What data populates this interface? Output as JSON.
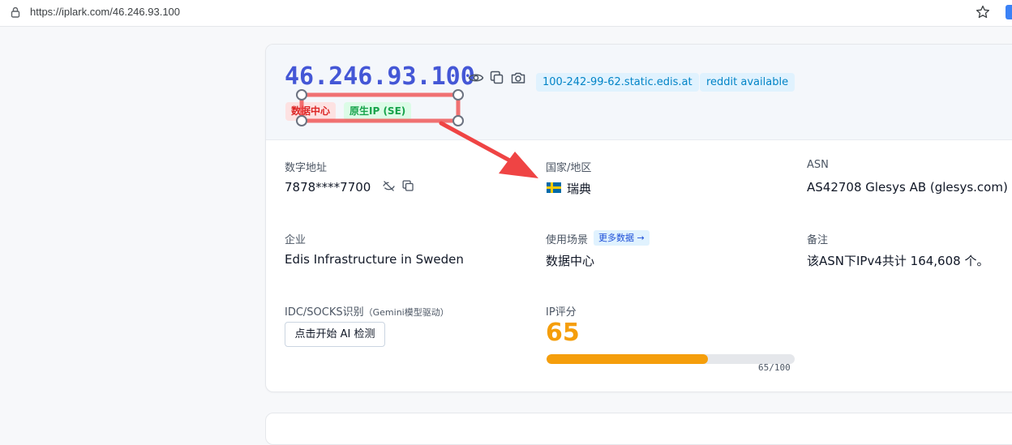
{
  "browser": {
    "url": "https://iplark.com/46.246.93.100"
  },
  "header": {
    "ip": "46.246.93.100",
    "hostname_chip": "100-242-99-62.static.edis.at",
    "reddit_chip": "reddit available",
    "tags": {
      "datacenter": "数据中心",
      "native": "原生IP (SE)"
    }
  },
  "fields": {
    "numeric": {
      "label": "数字地址",
      "value": "7878****7700"
    },
    "country": {
      "label": "国家/地区",
      "value": "瑞典"
    },
    "asn": {
      "label": "ASN",
      "value": "AS42708 Glesys AB (glesys.com)"
    },
    "company": {
      "label": "企业",
      "value": "Edis Infrastructure in Sweden"
    },
    "usage": {
      "label": "使用场景",
      "more": "更多数据 →",
      "value": "数据中心"
    },
    "note": {
      "label": "备注",
      "value": "该ASN下IPv4共计 164,608 个。"
    },
    "idc": {
      "label": "IDC/SOCKS识别",
      "sublabel": "（Gemini模型驱动）",
      "button": "点击开始 AI 检测"
    },
    "score": {
      "label": "IP评分",
      "value": "65",
      "bar_text": "65/100",
      "fraction": 0.65
    }
  },
  "colors": {
    "ip_blue": "#4457d6",
    "score_orange": "#f59e0b",
    "annotation_red": "#ef4444"
  },
  "icons": [
    "lock-icon",
    "star-icon",
    "eye-icon",
    "copy-icon",
    "camera-icon",
    "eye-off-icon",
    "sweden-flag-icon"
  ]
}
